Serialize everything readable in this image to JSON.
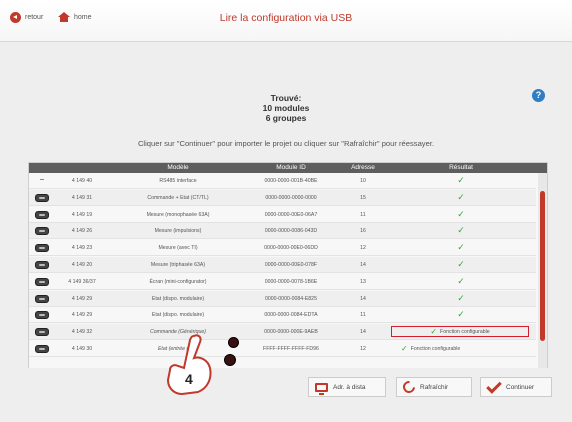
{
  "nav": {
    "back_label": "retour",
    "home_label": "home"
  },
  "title": "Lire la configuration via USB",
  "found": {
    "line1": "Trouvé:",
    "line2": "10 modules",
    "line3": "6 groupes"
  },
  "help": {
    "symbol": "?"
  },
  "instruction": "Cliquer sur \"Continuer\" pour importer le projet ou cliquer sur \"Rafraîchir\" pour réessayer.",
  "table": {
    "headers": {
      "model": "Modèle",
      "module_id": "Module ID",
      "address": "Adresse",
      "result": "Résultat"
    },
    "rows": [
      {
        "ref": "4 149 40",
        "model": "RS485 interface",
        "id": "0000-0000-001B-40BE",
        "address": "10",
        "result": "✓"
      },
      {
        "ref": "4 149 31",
        "model": "Commande + Etat (CT/TL)",
        "id": "0000-0000-0000-0000",
        "address": "15",
        "result": "✓"
      },
      {
        "ref": "4 149 19",
        "model": "Mesure (monophasée 63A)",
        "id": "0000-0000-00E0-06A7",
        "address": "11",
        "result": "✓"
      },
      {
        "ref": "4 149 26",
        "model": "Mesure (impulsions)",
        "id": "0000-0000-0086-043D",
        "address": "16",
        "result": "✓"
      },
      {
        "ref": "4 149 23",
        "model": "Mesure (avec TI)",
        "id": "0000-0000-00E0-06DD",
        "address": "12",
        "result": "✓"
      },
      {
        "ref": "4 149 20",
        "model": "Mesure (triphasée 63A)",
        "id": "0000-0000-00E0-078F",
        "address": "14",
        "result": "✓"
      },
      {
        "ref": "4 149 36/37",
        "model": "Écran (mini-configurator)",
        "id": "0000-0000-0078-1B6E",
        "address": "13",
        "result": "✓"
      },
      {
        "ref": "4 149 29",
        "model": "Etat (dispo. modulaire)",
        "id": "0000-0000-0084-E825",
        "address": "14",
        "result": "✓"
      },
      {
        "ref": "4 149 29",
        "model": "Etat (dispo. modulaire)",
        "id": "0000-0000-0084-EDTA",
        "address": "11",
        "result": "✓"
      },
      {
        "ref": "4 149 32",
        "model": "Commande (Générique)",
        "id": "0000-0000-000E-9AEB",
        "address": "14",
        "result": "Fonction configurable"
      },
      {
        "ref": "4 149 30",
        "model": "Etat (entrée géné",
        "id": "FFFF-FFFF-FFFF-FD96",
        "address": "12",
        "result": "Fonction configurable"
      }
    ]
  },
  "buttons": {
    "adr": "Adr. à dista",
    "refresh": "Rafraîchir",
    "continue": "Continuer"
  },
  "callout": {
    "number": "4"
  },
  "colors": {
    "accent": "#c0392b",
    "check": "#3aa53a",
    "highlight": "#d21e2e",
    "help": "#2f7dc2"
  }
}
